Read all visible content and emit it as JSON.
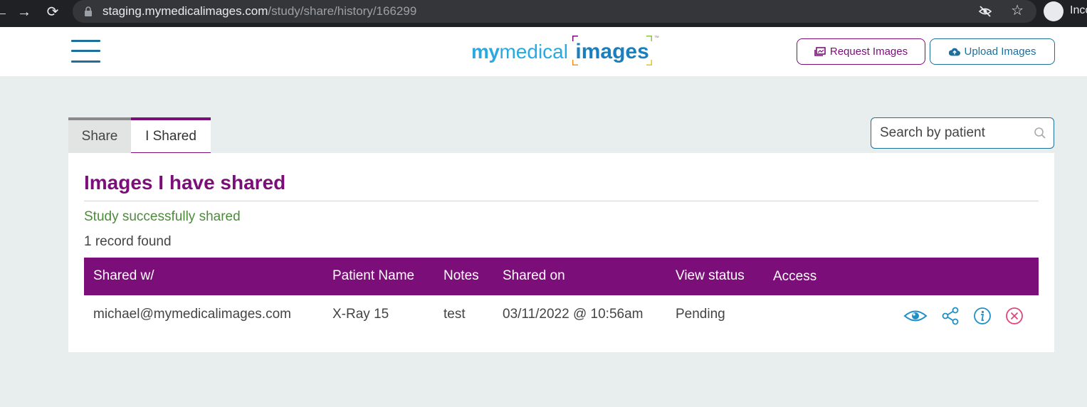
{
  "browser": {
    "url_host": "staging.mymedicalimages.com",
    "url_path": "/study/share/history/166299",
    "profile_label": "Inco"
  },
  "header": {
    "logo": {
      "my": "my",
      "medical": "medical",
      "images": "images",
      "tm": "™"
    },
    "request_button": "Request Images",
    "upload_button": "Upload Images"
  },
  "tabs": [
    {
      "label": "Share",
      "active": false
    },
    {
      "label": "I Shared",
      "active": true
    }
  ],
  "search": {
    "placeholder": "Search by patient"
  },
  "panel": {
    "title": "Images I have shared",
    "success_message": "Study successfully shared",
    "record_count": "1 record found"
  },
  "table": {
    "columns": [
      "Shared w/",
      "Patient Name",
      "Notes",
      "Shared on",
      "View status",
      "Access"
    ],
    "rows": [
      {
        "shared_with": "michael@mymedicalimages.com",
        "patient_name": "X-Ray 15",
        "notes": "test",
        "shared_on": "03/11/2022 @ 10:56am",
        "view_status": "Pending",
        "actions": [
          "eye-icon",
          "share-icon",
          "info-icon",
          "cancel-icon"
        ]
      }
    ]
  },
  "colors": {
    "brand_purple": "#7b0e78",
    "brand_blue": "#1f6f9c",
    "success_green": "#4e8a3b",
    "danger_pink": "#e0457b"
  }
}
